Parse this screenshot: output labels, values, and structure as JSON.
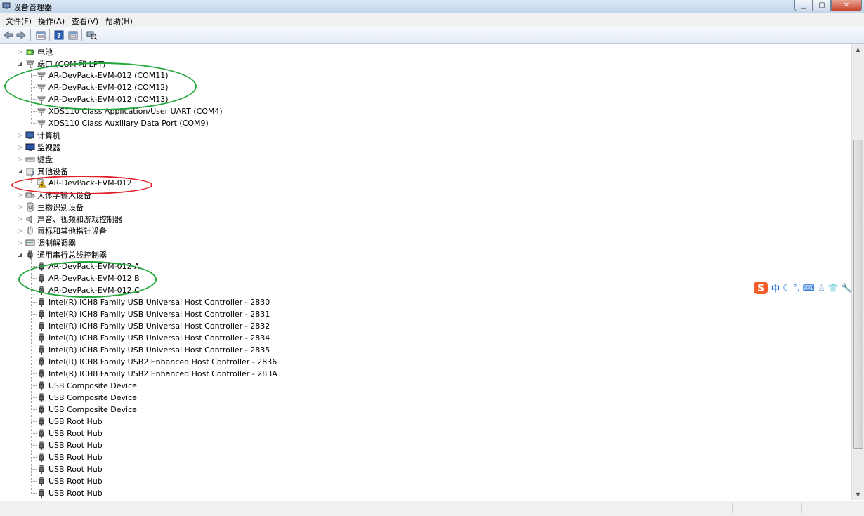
{
  "window": {
    "title": "设备管理器"
  },
  "menu": [
    "文件(F)",
    "操作(A)",
    "查看(V)",
    "帮助(H)"
  ],
  "toolbar": [
    "back-icon",
    "forward-icon",
    "properties-list-icon",
    "help-icon",
    "properties-icon",
    "scan-hardware-icon"
  ],
  "tree": [
    {
      "label": "电池",
      "level": 0,
      "expander": "collapsed",
      "icon": "battery"
    },
    {
      "label": "端口 (COM 和 LPT)",
      "level": 0,
      "expander": "expanded",
      "icon": "port"
    },
    {
      "label": "AR-DevPack-EVM-012 (COM11)",
      "level": 1,
      "icon": "port"
    },
    {
      "label": "AR-DevPack-EVM-012 (COM12)",
      "level": 1,
      "icon": "port"
    },
    {
      "label": "AR-DevPack-EVM-012 (COM13)",
      "level": 1,
      "icon": "port"
    },
    {
      "label": "XDS110 Class Application/User UART (COM4)",
      "level": 1,
      "icon": "port"
    },
    {
      "label": "XDS110 Class Auxiliary Data Port (COM9)",
      "level": 1,
      "icon": "port"
    },
    {
      "label": "计算机",
      "level": 0,
      "expander": "collapsed",
      "icon": "computer"
    },
    {
      "label": "监视器",
      "level": 0,
      "expander": "collapsed",
      "icon": "monitor"
    },
    {
      "label": "键盘",
      "level": 0,
      "expander": "collapsed",
      "icon": "keyboard"
    },
    {
      "label": "其他设备",
      "level": 0,
      "expander": "expanded",
      "icon": "other"
    },
    {
      "label": "AR-DevPack-EVM-012",
      "level": 1,
      "icon": "warning"
    },
    {
      "label": "人体学输入设备",
      "level": 0,
      "expander": "collapsed",
      "icon": "hid"
    },
    {
      "label": "生物识别设备",
      "level": 0,
      "expander": "collapsed",
      "icon": "bio"
    },
    {
      "label": "声音、视频和游戏控制器",
      "level": 0,
      "expander": "collapsed",
      "icon": "sound"
    },
    {
      "label": "鼠标和其他指针设备",
      "level": 0,
      "expander": "collapsed",
      "icon": "mouse"
    },
    {
      "label": "调制解调器",
      "level": 0,
      "expander": "collapsed",
      "icon": "modem"
    },
    {
      "label": "通用串行总线控制器",
      "level": 0,
      "expander": "expanded",
      "icon": "usb"
    },
    {
      "label": "AR-DevPack-EVM-012 A",
      "level": 1,
      "icon": "usb"
    },
    {
      "label": "AR-DevPack-EVM-012 B",
      "level": 1,
      "icon": "usb"
    },
    {
      "label": "AR-DevPack-EVM-012 C",
      "level": 1,
      "icon": "usb"
    },
    {
      "label": "Intel(R) ICH8 Family USB Universal Host Controller - 2830",
      "level": 1,
      "icon": "usb"
    },
    {
      "label": "Intel(R) ICH8 Family USB Universal Host Controller - 2831",
      "level": 1,
      "icon": "usb"
    },
    {
      "label": "Intel(R) ICH8 Family USB Universal Host Controller - 2832",
      "level": 1,
      "icon": "usb"
    },
    {
      "label": "Intel(R) ICH8 Family USB Universal Host Controller - 2834",
      "level": 1,
      "icon": "usb"
    },
    {
      "label": "Intel(R) ICH8 Family USB Universal Host Controller - 2835",
      "level": 1,
      "icon": "usb"
    },
    {
      "label": "Intel(R) ICH8 Family USB2 Enhanced Host Controller - 2836",
      "level": 1,
      "icon": "usb"
    },
    {
      "label": "Intel(R) ICH8 Family USB2 Enhanced Host Controller - 283A",
      "level": 1,
      "icon": "usb"
    },
    {
      "label": "USB Composite Device",
      "level": 1,
      "icon": "usb"
    },
    {
      "label": "USB Composite Device",
      "level": 1,
      "icon": "usb"
    },
    {
      "label": "USB Composite Device",
      "level": 1,
      "icon": "usb"
    },
    {
      "label": "USB Root Hub",
      "level": 1,
      "icon": "usb"
    },
    {
      "label": "USB Root Hub",
      "level": 1,
      "icon": "usb"
    },
    {
      "label": "USB Root Hub",
      "level": 1,
      "icon": "usb"
    },
    {
      "label": "USB Root Hub",
      "level": 1,
      "icon": "usb"
    },
    {
      "label": "USB Root Hub",
      "level": 1,
      "icon": "usb"
    },
    {
      "label": "USB Root Hub",
      "level": 1,
      "icon": "usb"
    },
    {
      "label": "USB Root Hub",
      "level": 1,
      "icon": "usb"
    }
  ],
  "annotation_colors": {
    "green": "#22a83a",
    "red": "#e0202a"
  },
  "ime": {
    "logo": "S",
    "mode": "中",
    "icons": [
      "moon-icon",
      "punctuation-icon",
      "keyboard-icon",
      "user-icon",
      "skin-icon",
      "settings-wrench-icon"
    ]
  }
}
